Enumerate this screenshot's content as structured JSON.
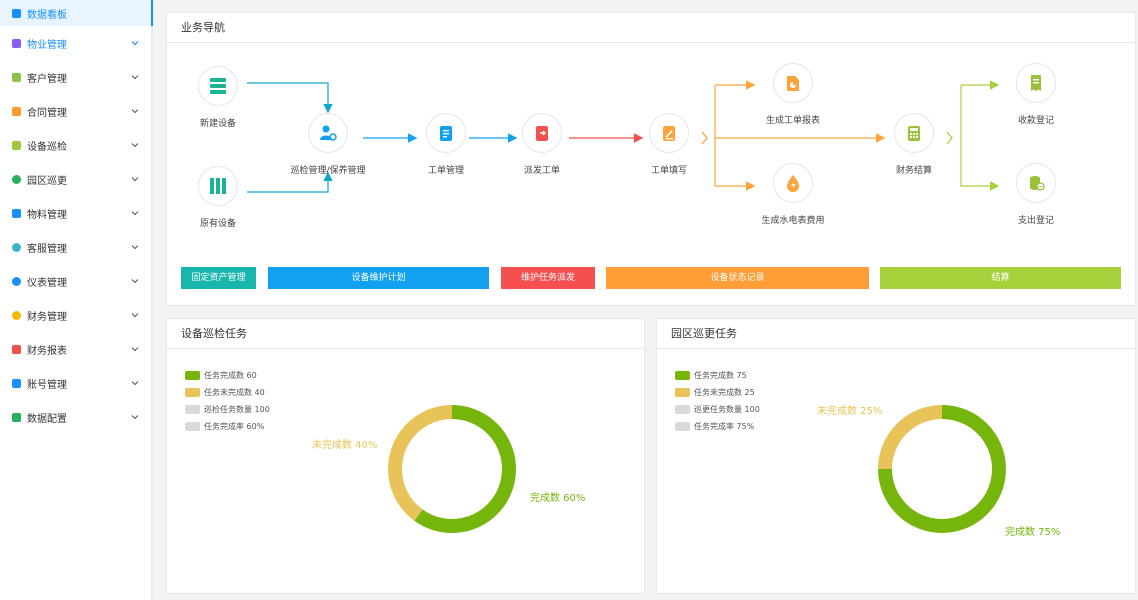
{
  "sidebar": {
    "items": [
      {
        "label": "数据看板",
        "icon": "dashboard-icon",
        "color": "#1890ff"
      },
      {
        "label": "物业管理",
        "icon": "building-icon",
        "color": "#8a5cf6"
      },
      {
        "label": "客户管理",
        "icon": "users-icon",
        "color": "#8bc34a"
      },
      {
        "label": "合同管理",
        "icon": "contract-icon",
        "color": "#ff9a2e"
      },
      {
        "label": "设备巡检",
        "icon": "inspect-icon",
        "color": "#a0c83c"
      },
      {
        "label": "园区巡更",
        "icon": "patrol-icon",
        "color": "#27ae60"
      },
      {
        "label": "物料管理",
        "icon": "material-icon",
        "color": "#1890ff"
      },
      {
        "label": "客服管理",
        "icon": "service-icon",
        "color": "#3cb4c8"
      },
      {
        "label": "仪表管理",
        "icon": "meter-icon",
        "color": "#1890ff"
      },
      {
        "label": "财务管理",
        "icon": "finance-icon",
        "color": "#f5b800"
      },
      {
        "label": "财务报表",
        "icon": "report-icon",
        "color": "#f0504a"
      },
      {
        "label": "账号管理",
        "icon": "account-icon",
        "color": "#1890ff"
      },
      {
        "label": "数据配置",
        "icon": "config-icon",
        "color": "#27ae60"
      }
    ]
  },
  "nav": {
    "title": "业务导航",
    "nodes": {
      "new_device": "新建设备",
      "existing_device": "原有设备",
      "inspection": "巡检管理/保养管理",
      "work_order_mgmt": "工单管理",
      "dispatch": "派发工单",
      "fill": "工单填写",
      "gen_report": "生成工单报表",
      "gen_utility": "生成水电表费用",
      "settlement": "财务结算",
      "income": "收款登记",
      "expense": "支出登记"
    },
    "buttons": [
      {
        "label": "固定资产管理",
        "color": "#19b6ad"
      },
      {
        "label": "设备维护计划",
        "color": "#12a1f1"
      },
      {
        "label": "维护任务派发",
        "color": "#f5504f"
      },
      {
        "label": "设备状态记录",
        "color": "#ff9d37"
      },
      {
        "label": "结算",
        "color": "#a6d13b"
      }
    ]
  },
  "equipment": {
    "title": "设备巡检任务",
    "legend": [
      {
        "label": "任务完成数 60",
        "color": "#76b60c"
      },
      {
        "label": "任务未完成数 40",
        "color": "#e8c35a"
      },
      {
        "label": "巡检任务数量 100",
        "color": "#d9d9d9"
      },
      {
        "label": "任务完成率 60%",
        "color": "#d9d9d9"
      }
    ],
    "done_label": "完成数 60%",
    "undone_label": "未完成数 40%"
  },
  "patrol": {
    "title": "园区巡更任务",
    "legend": [
      {
        "label": "任务完成数 75",
        "color": "#76b60c"
      },
      {
        "label": "任务未完成数 25",
        "color": "#e8c35a"
      },
      {
        "label": "巡更任务数量 100",
        "color": "#d9d9d9"
      },
      {
        "label": "任务完成率 75%",
        "color": "#d9d9d9"
      }
    ],
    "done_label": "完成数 75%",
    "undone_label": "未完成数 25%"
  },
  "chart_data": [
    {
      "type": "pie",
      "title": "设备巡检任务",
      "categories": [
        "完成数",
        "未完成数"
      ],
      "values": [
        60,
        40
      ],
      "colors": [
        "#76b60c",
        "#e8c35a"
      ],
      "legend": "top-left"
    },
    {
      "type": "pie",
      "title": "园区巡更任务",
      "categories": [
        "完成数",
        "未完成数"
      ],
      "values": [
        75,
        25
      ],
      "colors": [
        "#76b60c",
        "#e8c35a"
      ],
      "legend": "top-left"
    }
  ]
}
